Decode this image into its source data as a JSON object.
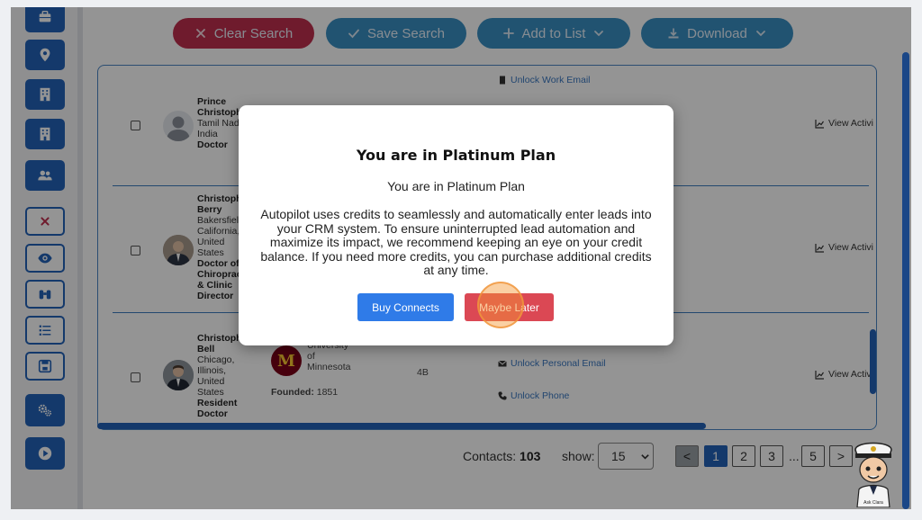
{
  "toolbar": {
    "clear_search": "Clear Search",
    "save_search": "Save Search",
    "add_to_list": "Add to List",
    "download": "Download"
  },
  "rows": [
    {
      "name_l1": "Prince",
      "name_l2": "Christoph",
      "loc_l1": "Tamil Nad",
      "loc_l2": "India",
      "title_l1": "Doctor",
      "link_top": "Unlock Work Email",
      "activity": "View Activi"
    },
    {
      "name_l1": "Christoph",
      "name_l2": "Berry",
      "loc_l1": "Bakersfiel",
      "loc_l2": "California,",
      "loc_l3": "United",
      "loc_l4": "States",
      "title_l1": "Doctor of",
      "title_l2": "Chiroprac",
      "title_l3": "& Clinic",
      "title_l4": "Director",
      "activity": "View Activi"
    },
    {
      "name_l1": "Christoph",
      "name_l2": "Bell",
      "loc_l1": "Chicago,",
      "loc_l2": "Illinois,",
      "loc_l3": "United",
      "loc_l4": "States",
      "title_l1": "Resident",
      "title_l2": "Doctor",
      "uni_l1": "University",
      "uni_l2": "of",
      "uni_l3": "Minnesota",
      "founded_label": "Founded:",
      "founded_value": "1851",
      "size": "4B",
      "link_email": "Unlock Personal Email",
      "link_phone": "Unlock Phone",
      "activity": "View Activi"
    }
  ],
  "footer": {
    "contacts_label": "Contacts:",
    "contacts_count": "103",
    "show_label": "show:",
    "show_value": "15",
    "pages": [
      "1",
      "2",
      "3",
      "5"
    ],
    "ellipsis": "...",
    "prev": "<",
    "next": ">"
  },
  "modal": {
    "title": "You are in Platinum Plan",
    "subtitle": "You are in Platinum Plan",
    "body": "Autopilot uses credits to seamlessly and automatically enter leads into your CRM system. To ensure uninterrupted lead automation and maximize its impact, we recommend keeping an eye on your credit balance. If you need more credits, you can purchase additional credits at any time.",
    "buy_label": "Buy Connects",
    "later_label": "Maybe Later"
  },
  "colors": {
    "primary": "#2463b8",
    "clear": "#c0304f",
    "toolbar": "#3a8fc3",
    "buy": "#2f7be8",
    "later": "#db4854"
  },
  "mascot": {
    "caption": "Ask Clara"
  }
}
